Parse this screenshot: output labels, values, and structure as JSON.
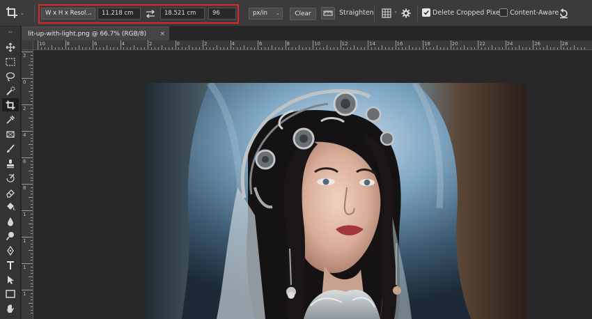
{
  "options_bar": {
    "tool_icon": "crop-icon",
    "ratio_dropdown": "W x H x Resol...",
    "width_value": "11.218 cm",
    "swap_icon": "swap-arrows-icon",
    "height_value": "18.521 cm",
    "resolution_value": "96",
    "units_dropdown": "px/in",
    "clear_label": "Clear",
    "straighten_label": "Straighten",
    "overlay_icon": "grid-overlay-icon",
    "settings_icon": "gear-icon",
    "delete_cropped_label": "Delete Cropped Pixels",
    "delete_cropped_checked": true,
    "content_aware_label": "Content-Aware",
    "content_aware_checked": false,
    "reset_icon": "reset-icon",
    "highlight_color": "#e0262b"
  },
  "document_tab": {
    "title": "lit-up-with-light.png @ 66.7% (RGB/8)",
    "close_glyph": "×"
  },
  "rulers": {
    "horizontal_labels": [
      "10",
      "8",
      "6",
      "4",
      "2",
      "0",
      "2",
      "4",
      "6",
      "8",
      "10",
      "12",
      "14",
      "16",
      "18",
      "20",
      "22",
      "24",
      "26",
      "28"
    ],
    "vertical_labels": [
      "2",
      "0",
      "2",
      "4",
      "6",
      "8",
      "1",
      "1",
      "1",
      "1",
      "2"
    ]
  },
  "tools": [
    {
      "name": "move-tool-icon",
      "active": false
    },
    {
      "name": "marquee-tool-icon",
      "active": false
    },
    {
      "name": "lasso-tool-icon",
      "active": false
    },
    {
      "name": "quick-selection-tool-icon",
      "active": false
    },
    {
      "name": "crop-tool-icon",
      "active": true
    },
    {
      "name": "eyedropper-tool-icon",
      "active": false
    },
    {
      "name": "frame-tool-icon",
      "active": false
    },
    {
      "name": "brush-tool-icon",
      "active": false
    },
    {
      "name": "clone-stamp-tool-icon",
      "active": false
    },
    {
      "name": "history-brush-tool-icon",
      "active": false
    },
    {
      "name": "eraser-tool-icon",
      "active": false
    },
    {
      "name": "paint-bucket-tool-icon",
      "active": false
    },
    {
      "name": "blur-tool-icon",
      "active": false
    },
    {
      "name": "dodge-tool-icon",
      "active": false
    },
    {
      "name": "pen-tool-icon",
      "active": false
    },
    {
      "name": "type-tool-icon",
      "active": false
    },
    {
      "name": "path-selection-tool-icon",
      "active": false
    },
    {
      "name": "rectangle-tool-icon",
      "active": false
    },
    {
      "name": "hand-tool-icon",
      "active": false
    }
  ]
}
